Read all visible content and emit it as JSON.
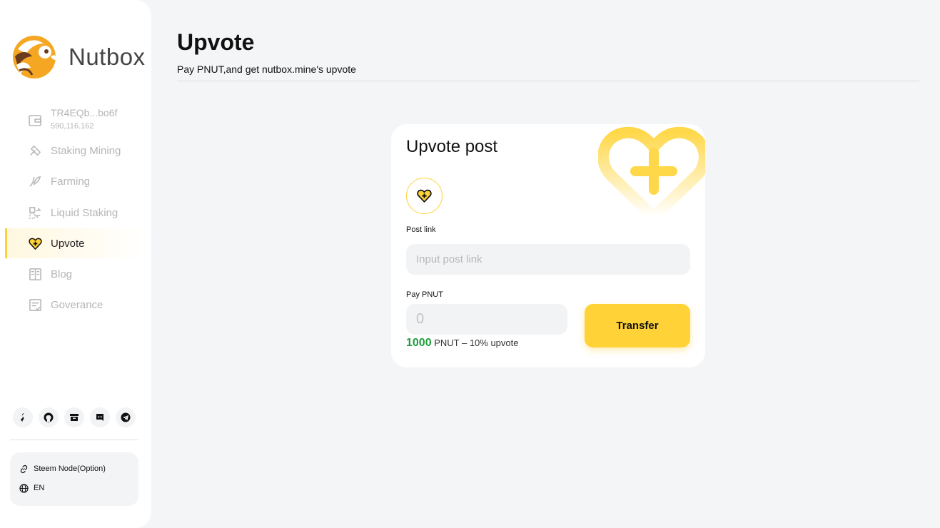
{
  "app": {
    "name": "Nutbox"
  },
  "wallet": {
    "address": "TR4EQb...bo6f",
    "balance": "590,116.162"
  },
  "sidebar": {
    "items": [
      {
        "label": "Staking Mining",
        "icon": "staking-icon",
        "active": false
      },
      {
        "label": "Farming",
        "icon": "farming-icon",
        "active": false
      },
      {
        "label": "Liquid Staking",
        "icon": "liquid-staking-icon",
        "active": false
      },
      {
        "label": "Upvote",
        "icon": "upvote-heart-icon",
        "active": true
      },
      {
        "label": "Blog",
        "icon": "blog-icon",
        "active": false
      },
      {
        "label": "Goverance",
        "icon": "governance-icon",
        "active": false
      }
    ],
    "social": [
      "steem-icon",
      "github-icon",
      "archive-icon",
      "discord-icon",
      "telegram-icon"
    ],
    "settings": {
      "node_label": "Steem Node(Option)",
      "language": "EN"
    }
  },
  "main": {
    "title": "Upvote",
    "subtitle": "Pay PNUT,and get nutbox.mine's upvote"
  },
  "card": {
    "title": "Upvote post",
    "post_link_label": "Post link",
    "post_link_placeholder": "Input post link",
    "pay_label": "Pay PNUT",
    "pay_placeholder": "0",
    "rate_amount": "1000",
    "rate_text": "PNUT – 10% upvote",
    "transfer_label": "Transfer"
  },
  "colors": {
    "accent": "#ffd337",
    "rate_green": "#1f9d3c",
    "background": "#f4f5f7"
  }
}
